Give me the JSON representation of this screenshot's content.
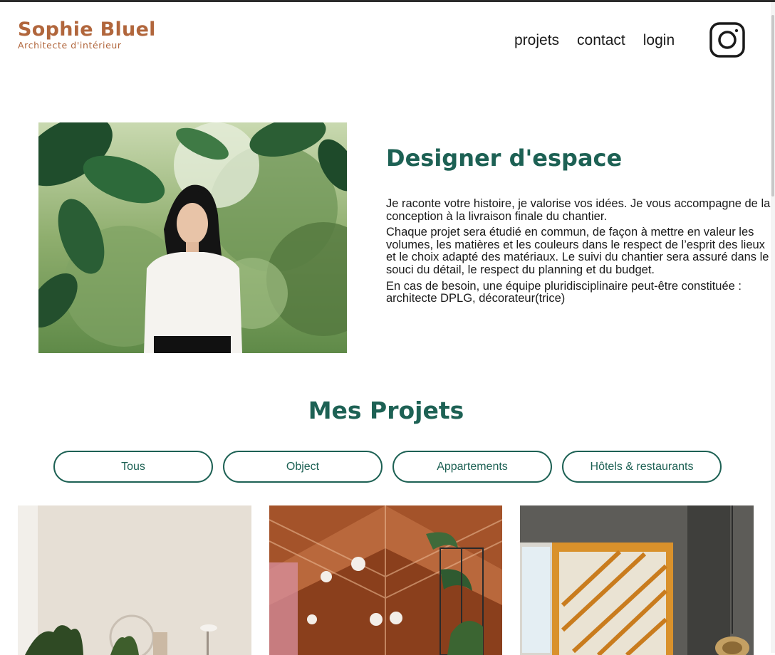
{
  "header": {
    "logo_title": "Sophie Bluel",
    "logo_subtitle": "Architecte d'intérieur",
    "nav": [
      "projets",
      "contact",
      "login"
    ],
    "social_icon": "instagram-icon"
  },
  "about": {
    "portrait_alt": "Sophie Bluel",
    "title": "Designer d'espace",
    "paragraphs": [
      "Je raconte votre histoire, je valorise vos idées. Je vous accompagne de la conception à la livraison finale du chantier.",
      "Chaque projet sera étudié en commun, de façon à mettre en valeur les volumes, les matières et les couleurs dans le respect de l’esprit des lieux et le choix adapté des matériaux. Le suivi du chantier sera assuré dans le souci du détail, le respect du planning et du budget.",
      "En cas de besoin, une équipe pluridisciplinaire peut-être constituée : architecte DPLG, décorateur(trice)"
    ]
  },
  "projects": {
    "title": "Mes Projets",
    "filters": [
      "Tous",
      "Object",
      "Appartements",
      "Hôtels & restaurants"
    ]
  },
  "colors": {
    "brand": "#b1663c",
    "accent": "#1d6154",
    "text": "#1a1a1a"
  }
}
